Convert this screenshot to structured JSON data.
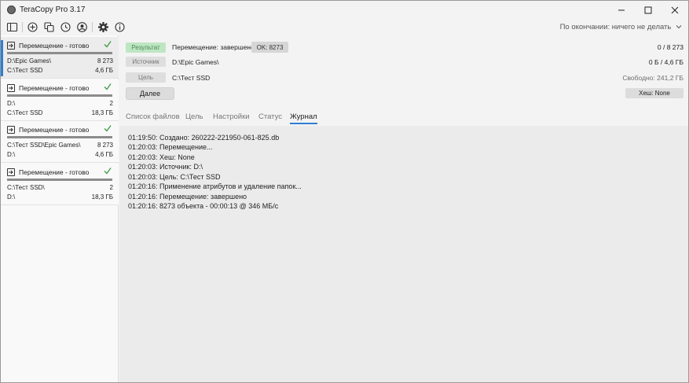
{
  "window": {
    "title": "TeraCopy Pro 3.17"
  },
  "toolbar": {
    "after_done": "По окончании: ничего не делать"
  },
  "jobs": [
    {
      "title": "Перемещение - готово",
      "src": "D:\\Epic Games\\",
      "dst": "C:\\Тест SSD",
      "count": "8 273",
      "size": "4,6 ГБ"
    },
    {
      "title": "Перемещение - готово",
      "src": "D:\\",
      "dst": "C:\\Тест SSD",
      "count": "2",
      "size": "18,3 ГБ"
    },
    {
      "title": "Перемещение - готово",
      "src": "C:\\Тест SSD\\Epic Games\\",
      "dst": "D:\\",
      "count": "8 273",
      "size": "4,6 ГБ"
    },
    {
      "title": "Перемещение - готово",
      "src": "C:\\Тест SSD\\",
      "dst": "D:\\",
      "count": "2",
      "size": "18,3 ГБ"
    }
  ],
  "info": {
    "result_label": "Результат",
    "result_value": "Перемещение: завершено",
    "ok_badge": "OK: 8273",
    "count_right": "0 / 8 273",
    "source_label": "Источник",
    "source_value": "D:\\Epic Games\\",
    "size_right": "0 Б / 4,6 ГБ",
    "target_label": "Цель",
    "target_value": "C:\\Тест SSD",
    "free_right": "Свободно: 241,2 ГБ",
    "next_button": "Далее",
    "hash_button": "Хеш: None"
  },
  "tabs": [
    "Список файлов",
    "Цель",
    "Настройки",
    "Статус",
    "Журнал"
  ],
  "active_tab": "Журнал",
  "log": [
    "01:19:50: Создано: 260222-221950-061-825.db",
    "01:20:03: Перемещение...",
    "01:20:03: Хеш: None",
    "01:20:03: Источник: D:\\",
    "01:20:03: Цель: C:\\Тест SSD",
    "01:20:16: Применение атрибутов и удаление папок...",
    "01:20:16: Перемещение: завершено",
    "01:20:16: 8273 объекта - 00:00:13 @ 346 МБ/с"
  ],
  "colors": {
    "accent": "#2f7fd1",
    "success": "#3c9a45",
    "result_badge": "#bfe6c3"
  }
}
